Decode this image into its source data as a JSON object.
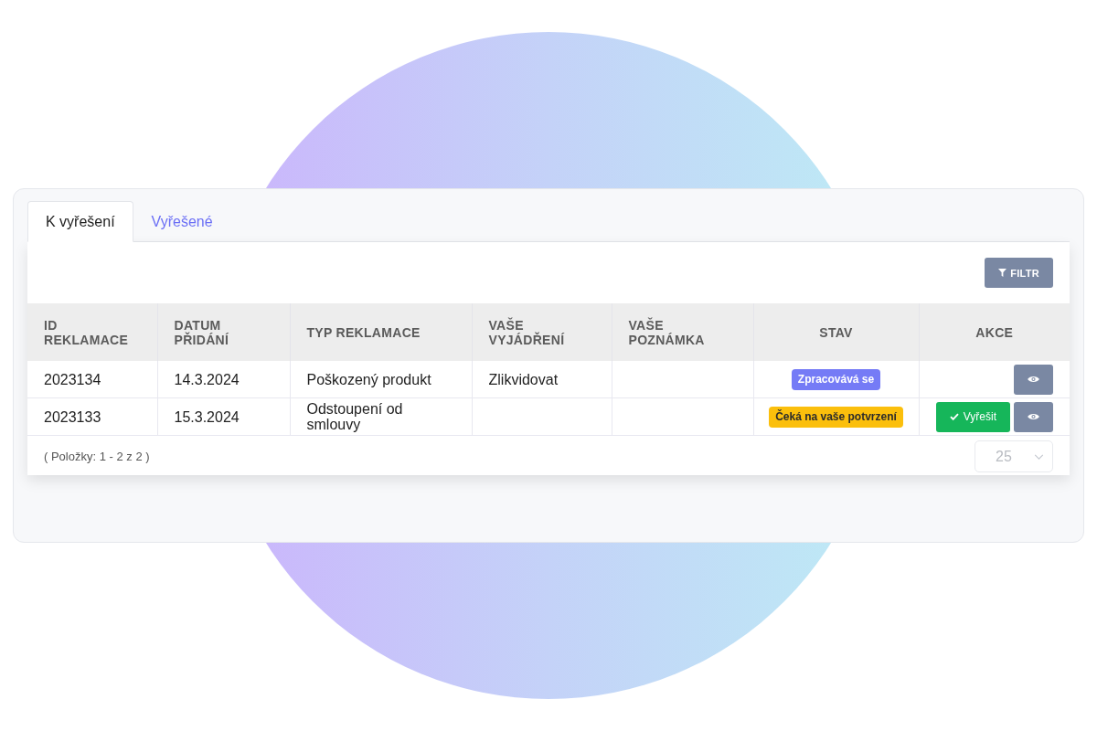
{
  "tabs": [
    {
      "label": "K vyřešení",
      "selected": true
    },
    {
      "label": "Vyřešené",
      "selected": false
    }
  ],
  "toolbar": {
    "filter_button": "FILTR"
  },
  "table": {
    "columns": [
      "ID REKLAMACE",
      "DATUM PŘIDÁNÍ",
      "TYP REKLAMACE",
      "VAŠE VYJÁDŘENÍ",
      "VAŠE POZNÁMKA",
      "STAV",
      "AKCE"
    ],
    "rows": [
      {
        "id": "2023134",
        "date": "14.3.2024",
        "type": "Poškozený produkt",
        "response": "Zlikvidovat",
        "status": {
          "label": "Zpracovává se",
          "color": "#757bf6"
        },
        "actions": [
          {
            "kind": "view"
          }
        ]
      },
      {
        "id": "2023133",
        "date": "15.3.2024",
        "type": "Odstoupení od smlouvy",
        "status": {
          "label": "Čeká na vaše potvrzení",
          "color": "#fbbf0c"
        },
        "actions": [
          {
            "kind": "resolve",
            "label": "Vyřešit"
          },
          {
            "kind": "view"
          }
        ]
      }
    ]
  },
  "footer": {
    "items_info": "( Položky: 1 - 2 z 2 )",
    "page_size": "25"
  }
}
